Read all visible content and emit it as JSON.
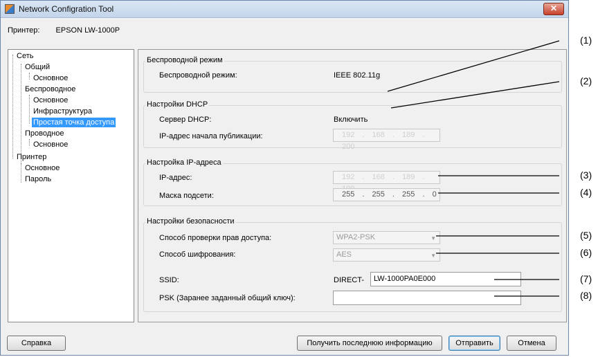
{
  "window": {
    "title": "Network Configration Tool",
    "close_glyph": "✕"
  },
  "printer": {
    "label": "Принтер:",
    "name": "EPSON LW-1000P"
  },
  "tree": [
    "Сеть",
    "Общий",
    "Основное",
    "Беспроводное",
    "Основное",
    "Инфраструктура",
    "Простая точка доступа",
    "Проводное",
    "Основное",
    "Принтер",
    "Основное",
    "Пароль"
  ],
  "tree_selected_index": 6,
  "wireless": {
    "title": "Беспроводной режим",
    "mode_label": "Беспроводной режим:",
    "mode_value": "IEEE 802.11g"
  },
  "dhcp": {
    "title": "Настройки DHCP",
    "server_label": "Сервер DHCP:",
    "server_value": "Включить",
    "start_label": "IP-адрес начала публикации:",
    "start_value": "192 . 168 . 189 . 200"
  },
  "ip": {
    "title": "Настройка IP-адреса",
    "ip_label": "IP-адрес:",
    "ip_value": "192 . 168 . 189 . 199",
    "mask_label": "Маска подсети:",
    "mask_value": "255 . 255 . 255 . 0"
  },
  "security": {
    "title": "Настройки безопасности",
    "auth_label": "Способ проверки прав доступа:",
    "auth_value": "WPA2-PSK",
    "enc_label": "Способ шифрования:",
    "enc_value": "AES",
    "ssid_label": "SSID:",
    "ssid_prefix": "DIRECT-",
    "ssid_value": "LW-1000PA0E000",
    "psk_label": "PSK (Заранее заданный общий ключ):",
    "psk_value": ""
  },
  "buttons": {
    "help": "Справка",
    "refresh": "Получить последнюю информацию",
    "send": "Отправить",
    "cancel": "Отмена"
  },
  "callouts": [
    "(1)",
    "(2)",
    "(3)",
    "(4)",
    "(5)",
    "(6)",
    "(7)",
    "(8)"
  ]
}
